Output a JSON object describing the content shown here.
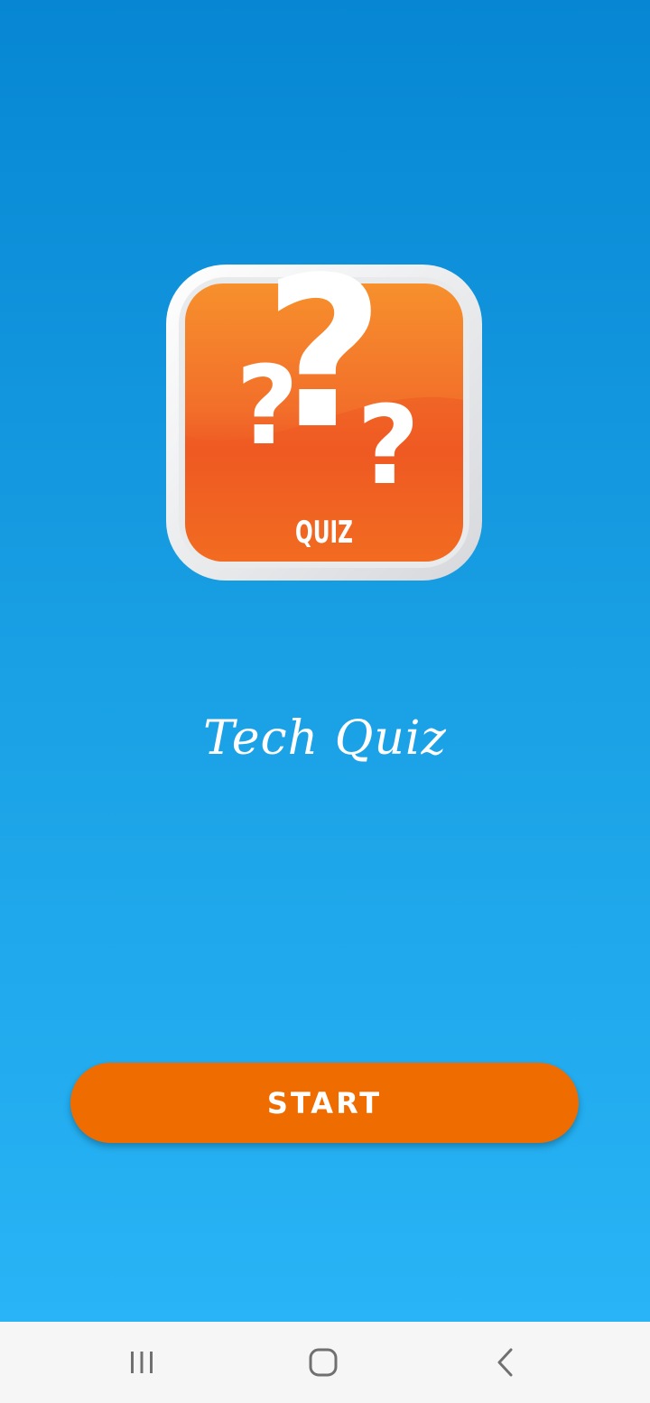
{
  "app": {
    "title": "Tech Quiz",
    "logo_text": "QUIZ",
    "start_label": "START"
  },
  "nav": {
    "recents_icon": "recents-icon",
    "home_icon": "home-icon",
    "back_icon": "back-icon"
  },
  "colors": {
    "background_top": "#0787d3",
    "background_bottom": "#28b4f6",
    "button": "#ef6c00",
    "logo_orange": "#f26a21",
    "nav_bar": "#f6f6f6"
  }
}
